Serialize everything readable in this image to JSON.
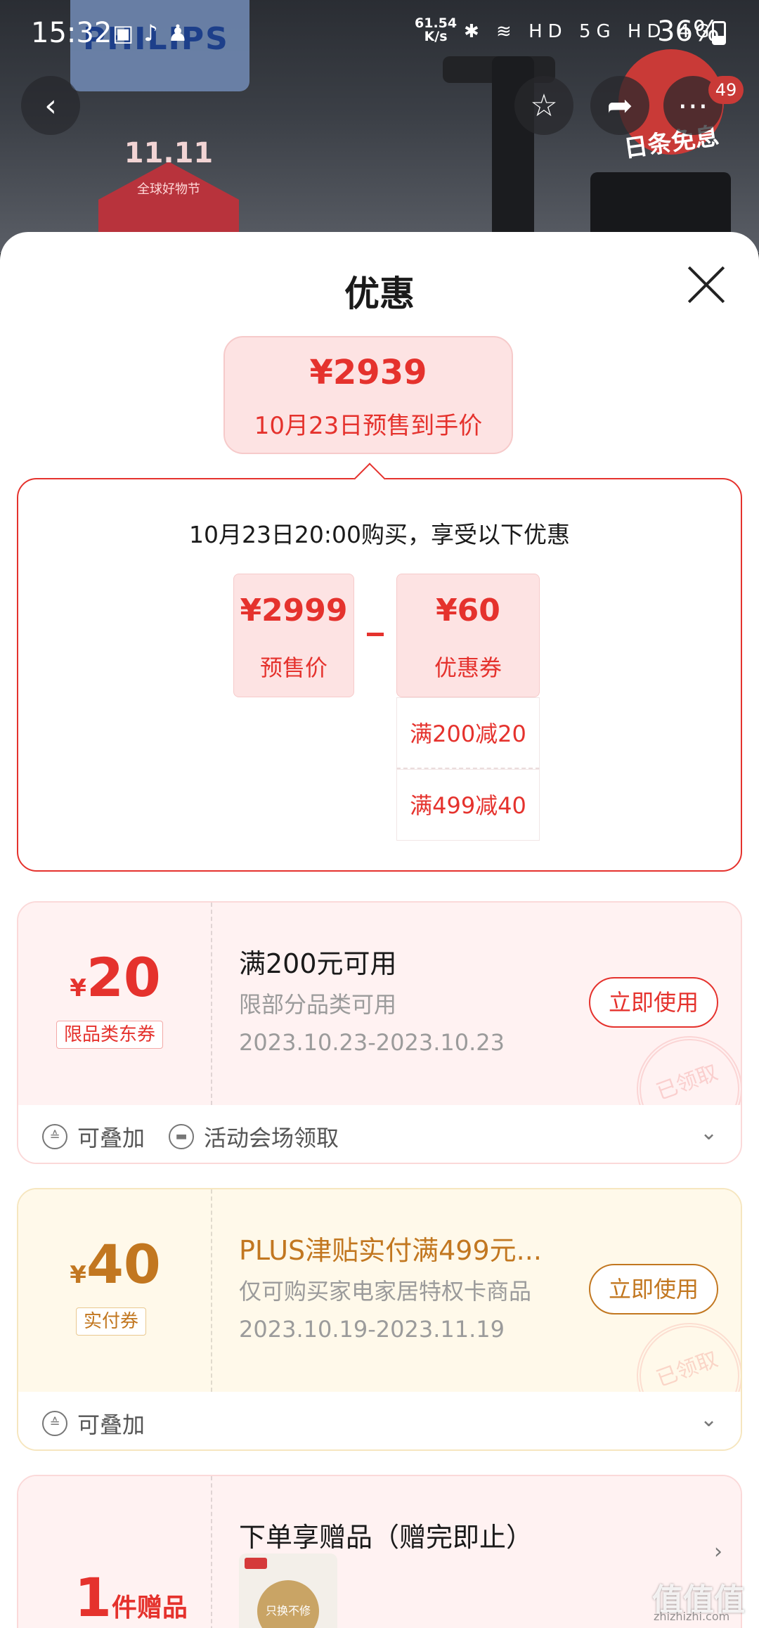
{
  "status_bar": {
    "time": "15:32",
    "net_speed_value": "61.54",
    "net_speed_unit": "K/s",
    "signal": "HD 5G HD 4G",
    "battery": "36%"
  },
  "background": {
    "brand": "PHILIPS",
    "promo_big": "11.11",
    "promo_text": "全球好物节",
    "red_badge": "日条免息",
    "cart_count": "49"
  },
  "sheet": {
    "title": "优惠",
    "final_price": {
      "amount": "¥2939",
      "label": "10月23日预售到手价"
    },
    "breakdown": {
      "desc": "10月23日20:00购买，享受以下优惠",
      "presale": {
        "value": "¥2999",
        "label": "预售价"
      },
      "coupon": {
        "value": "¥60",
        "label": "优惠券"
      },
      "sub_coupons": [
        "满200减20",
        "满499减40"
      ]
    },
    "coupons": [
      {
        "yen": "¥",
        "amount": "20",
        "tag": "限品类东券",
        "title": "满200元可用",
        "subtitle": "限部分品类可用",
        "date": "2023.10.23-2023.10.23",
        "button": "立即使用",
        "stamp": "已领取",
        "features": [
          "可叠加",
          "活动会场领取"
        ]
      },
      {
        "yen": "¥",
        "amount": "40",
        "tag": "实付券",
        "title": "PLUS津贴实付满499元...",
        "subtitle": "仅可购买家电家居特权卡商品",
        "date": "2023.10.19-2023.11.19",
        "button": "立即使用",
        "stamp": "已领取",
        "features": [
          "可叠加"
        ]
      }
    ],
    "gift": {
      "count": "1",
      "unit": "件赠品",
      "title": "下单享赠品（赠完即止）",
      "thumb_text": "只换不修"
    }
  },
  "watermark": {
    "main": "值值值",
    "sub": "zhizhizhi.com"
  }
}
